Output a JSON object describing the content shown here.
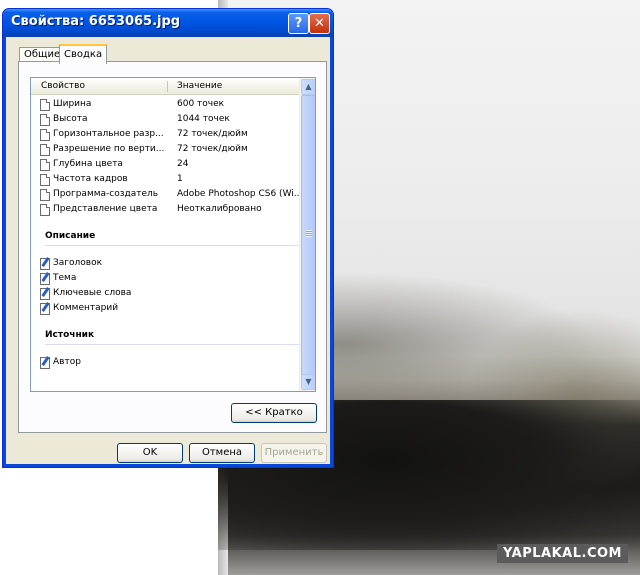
{
  "window": {
    "title": "Свойства: 6653065.jpg",
    "help_label": "?",
    "close_label": "✕"
  },
  "tabs": [
    {
      "label": "Общие"
    },
    {
      "label": "Сводка"
    }
  ],
  "list": {
    "columns": [
      "Свойство",
      "Значение"
    ],
    "image_rows": [
      {
        "property": "Ширина",
        "value": "600 точек"
      },
      {
        "property": "Высота",
        "value": "1044 точек"
      },
      {
        "property": "Горизонтальное разр...",
        "value": "72 точек/дюйм"
      },
      {
        "property": "Разрешение по верти...",
        "value": "72 точек/дюйм"
      },
      {
        "property": "Глубина цвета",
        "value": "24"
      },
      {
        "property": "Частота кадров",
        "value": "1"
      },
      {
        "property": "Программа-создатель",
        "value": "Adobe Photoshop CS6 (Wi..."
      },
      {
        "property": "Представление цвета",
        "value": "Неоткалибровано"
      }
    ],
    "description_heading": "Описание",
    "description_rows": [
      {
        "property": "Заголовок"
      },
      {
        "property": "Тема"
      },
      {
        "property": "Ключевые слова"
      },
      {
        "property": "Комментарий"
      }
    ],
    "source_heading": "Источник",
    "source_rows": [
      {
        "property": "Автор"
      }
    ]
  },
  "buttons": {
    "brief": "<< Кратко",
    "ok": "OK",
    "cancel": "Отмена",
    "apply": "Применить"
  },
  "watermark": "YAPLAKAL.COM"
}
